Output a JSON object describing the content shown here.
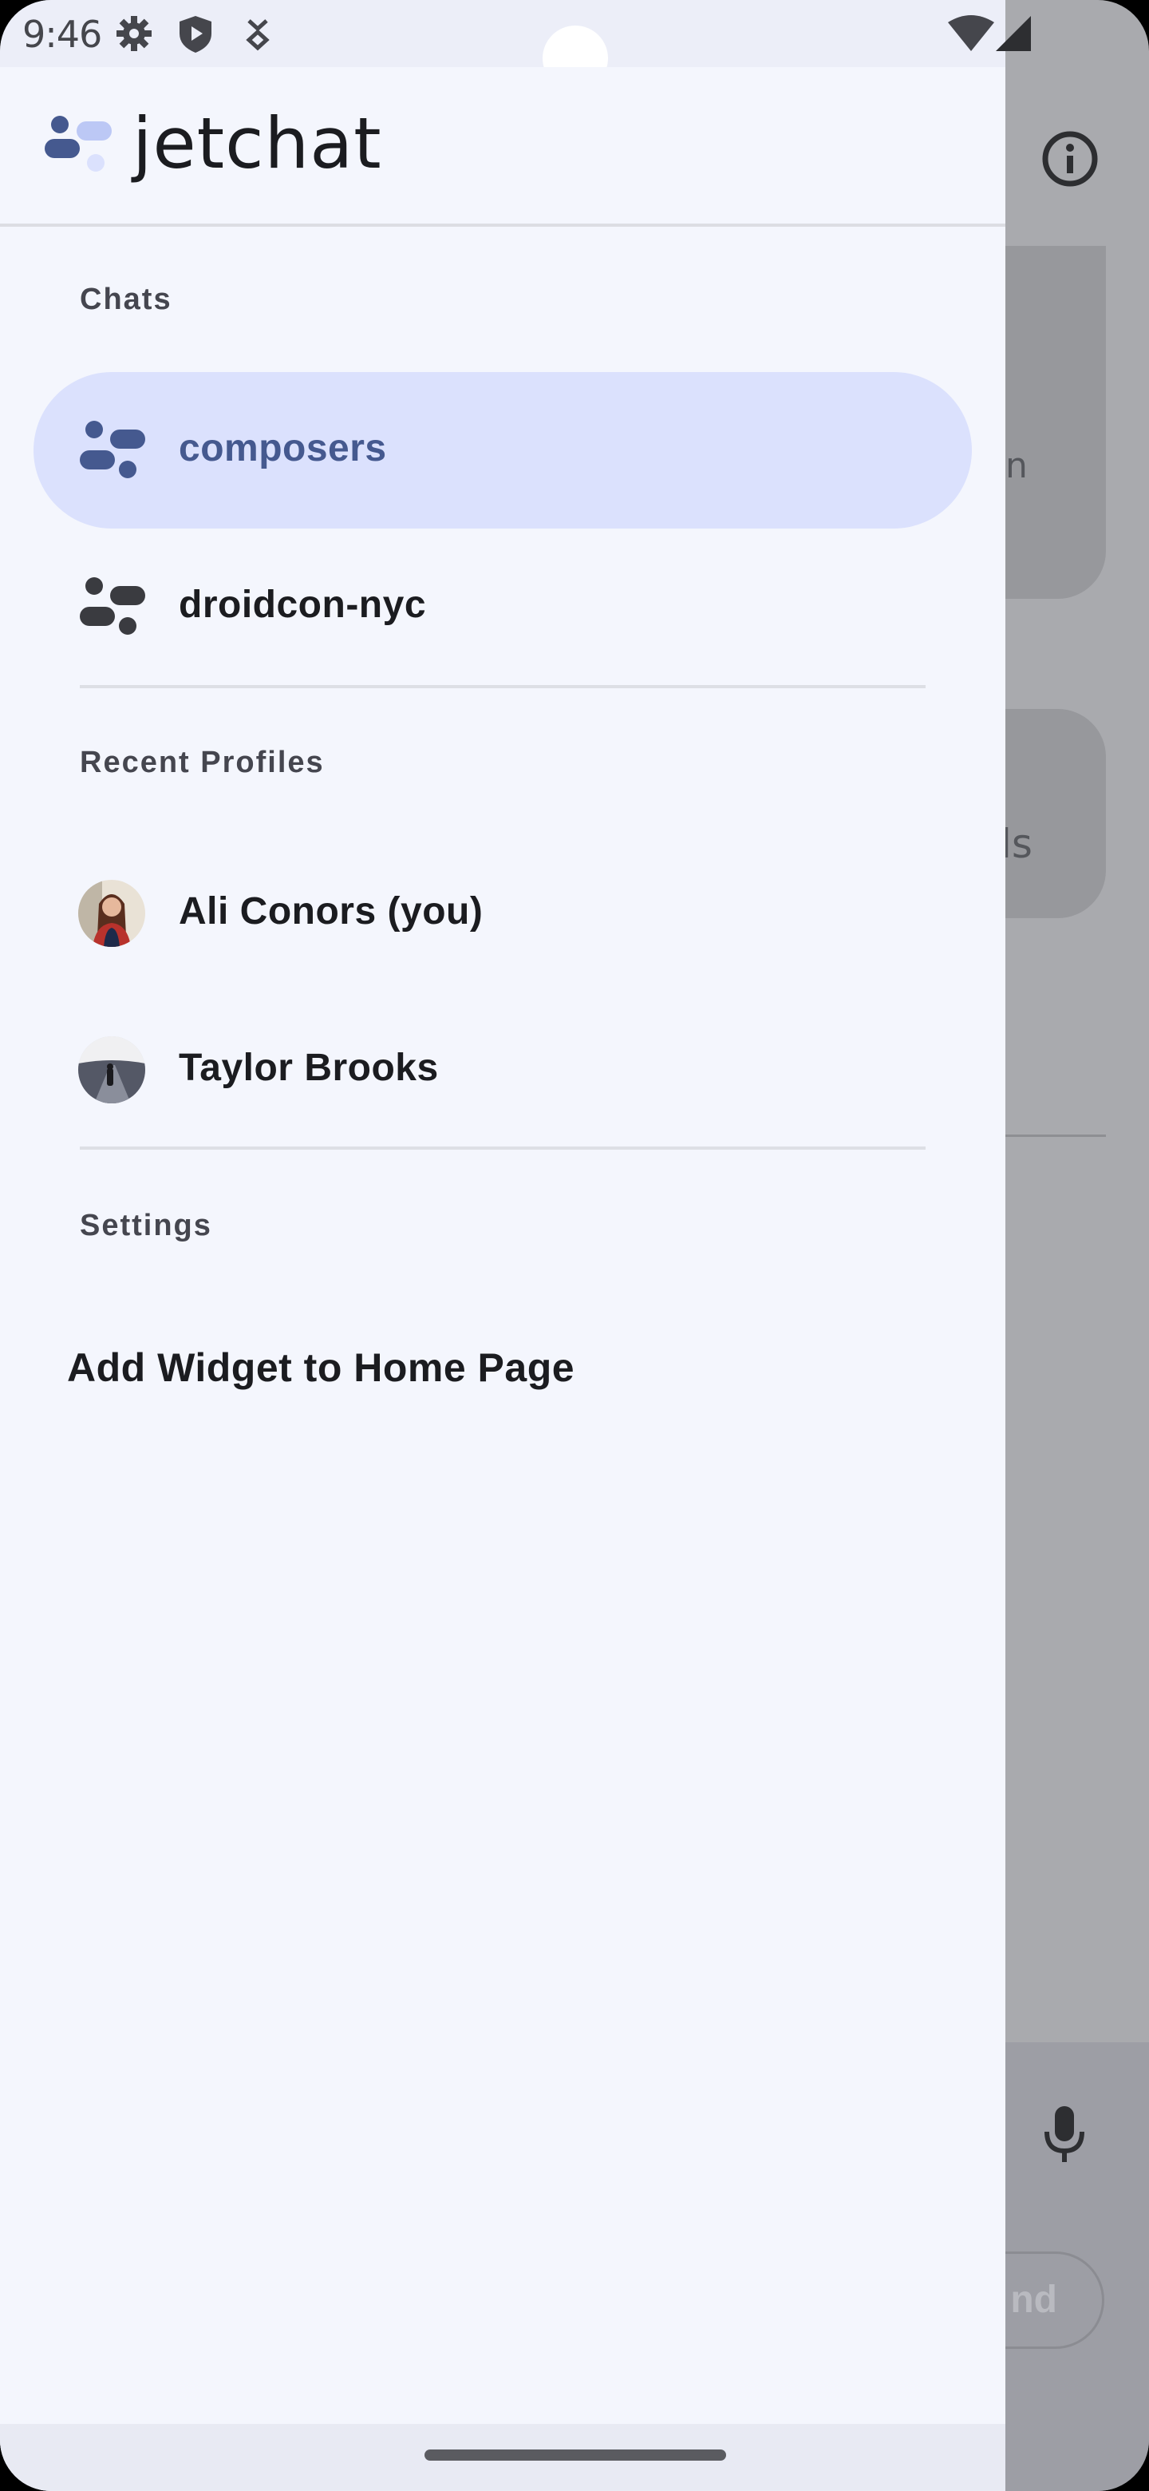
{
  "status_bar": {
    "time": "9:46",
    "icons": [
      "settings-icon",
      "shield-play-icon",
      "tethering-icon",
      "wifi-icon",
      "signal-icon"
    ]
  },
  "drawer": {
    "app_name": "jetchat",
    "sections": {
      "chats": {
        "title": "Chats",
        "items": [
          {
            "label": "composers",
            "selected": true
          },
          {
            "label": "droidcon-nyc",
            "selected": false
          }
        ]
      },
      "recent_profiles": {
        "title": "Recent Profiles",
        "items": [
          {
            "label": "Ali Conors (you)"
          },
          {
            "label": "Taylor Brooks"
          }
        ]
      },
      "settings": {
        "title": "Settings",
        "items": [
          {
            "label": "Add Widget to Home Page"
          }
        ]
      }
    }
  },
  "background": {
    "bubble1_fragment": "n",
    "bubble2_fragment": "ls",
    "send_fragment": "nd"
  },
  "colors": {
    "drawer_bg": "#f4f6fd",
    "selected_bg": "#dbe1fd",
    "accent": "#45598f",
    "scrim": "#a9aaae"
  }
}
